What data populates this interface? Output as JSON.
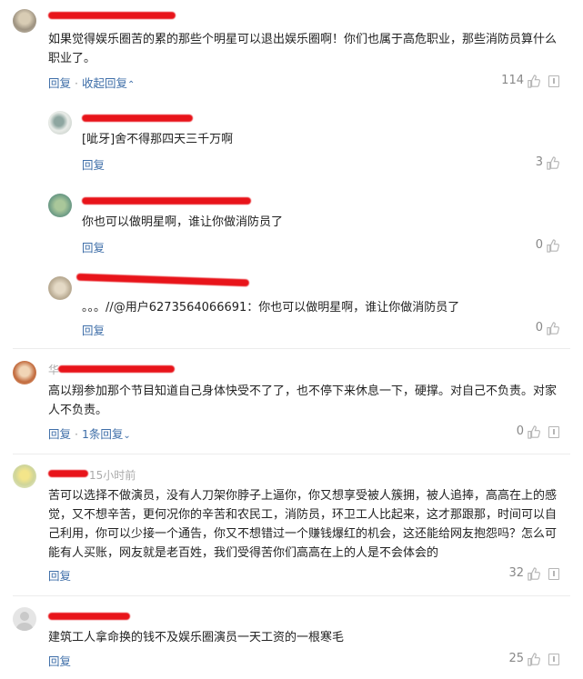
{
  "comments": [
    {
      "meta": "",
      "text": "如果觉得娱乐圈苦的累的那些个明星可以退出娱乐圈啊！你们也属于高危职业，那些消防员算什么职业了。",
      "reply_label": "回复",
      "toggle_label": "收起回复",
      "likes": "114",
      "replies": [
        {
          "meta": "",
          "text": "[呲牙]舍不得那四天三千万啊",
          "reply_label": "回复",
          "likes": "3"
        },
        {
          "meta": "",
          "text": "你也可以做明星啊，谁让你做消防员了",
          "reply_label": "回复",
          "likes": "0"
        },
        {
          "meta": "",
          "text": "。。。//@用户6273564066691：你也可以做明星啊，谁让你做消防员了",
          "reply_label": "回复",
          "likes": "0"
        }
      ]
    },
    {
      "meta": "华",
      "text": "高以翔参加那个节目知道自己身体快受不了了，也不停下来休息一下，硬撑。对自己不负责。对家人不负责。",
      "reply_label": "回复",
      "toggle_label": "1条回复",
      "likes": "0"
    },
    {
      "meta": "15小时前",
      "text": "苦可以选择不做演员，没有人刀架你脖子上逼你，你又想享受被人簇拥，被人追捧，高高在上的感觉，又不想辛苦，更何况你的辛苦和农民工，消防员，环卫工人比起来，这才那跟那，时间可以自己利用，你可以少接一个通告，你又不想错过一个赚钱爆红的机会，这还能给网友抱怨吗？怎么可能有人买账，网友就是老百姓，我们受得苦你们高高在上的人是不会体会的",
      "reply_label": "回复",
      "likes": "32"
    },
    {
      "meta": "",
      "text": "建筑工人拿命换的钱不及娱乐圈演员一天工资的一根寒毛",
      "reply_label": "回复",
      "likes": "25"
    }
  ],
  "colors": {
    "link": "#3e6ea8",
    "redaction": "#e8141a",
    "meta": "#aaaaaa",
    "count": "#888888"
  },
  "icons": {
    "like": "thumbs-up-icon",
    "more": "more-icon",
    "expand": "chevron-down-icon",
    "collapse": "chevron-up-icon"
  }
}
